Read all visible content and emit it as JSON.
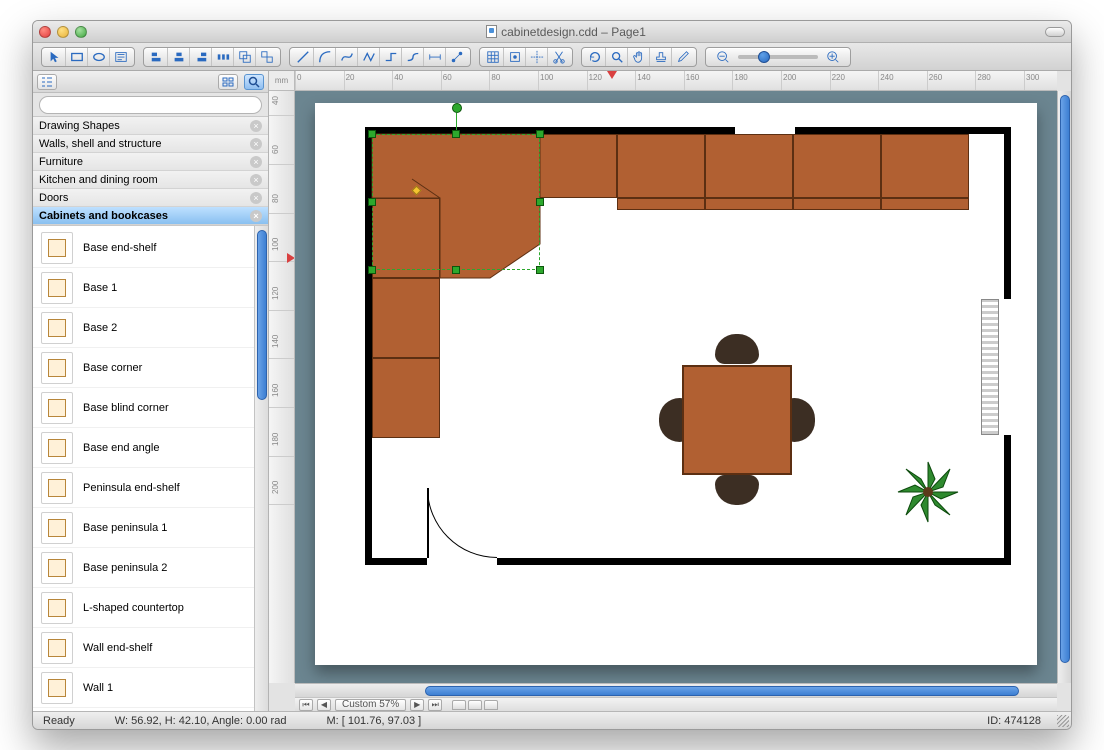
{
  "window": {
    "title": "cabinetdesign.cdd – Page1"
  },
  "ruler_unit": "mm",
  "search": {
    "placeholder": ""
  },
  "categories": [
    {
      "label": "Drawing Shapes"
    },
    {
      "label": "Walls, shell and structure"
    },
    {
      "label": "Furniture"
    },
    {
      "label": "Kitchen and dining room"
    },
    {
      "label": "Doors"
    },
    {
      "label": "Cabinets and bookcases",
      "active": true
    }
  ],
  "shapes": [
    {
      "label": "Base end-shelf"
    },
    {
      "label": "Base 1"
    },
    {
      "label": "Base 2"
    },
    {
      "label": "Base corner"
    },
    {
      "label": "Base blind corner"
    },
    {
      "label": "Base end angle"
    },
    {
      "label": "Peninsula end-shelf"
    },
    {
      "label": "Base peninsula 1"
    },
    {
      "label": "Base peninsula 2"
    },
    {
      "label": "L-shaped countertop"
    },
    {
      "label": "Wall end-shelf"
    },
    {
      "label": "Wall 1"
    }
  ],
  "h_ticks": [
    0,
    20,
    40,
    60,
    80,
    100,
    120,
    140,
    160,
    180,
    200,
    220,
    240,
    260,
    280,
    300
  ],
  "v_ticks": [
    40,
    60,
    80,
    100,
    120,
    140,
    160,
    180,
    200
  ],
  "pager": {
    "zoom_label": "Custom 57%"
  },
  "status": {
    "ready": "Ready",
    "dims": "W: 56.92,  H: 42.10,  Angle: 0.00 rad",
    "mouse": "M: [ 101.76, 97.03 ]",
    "id": "ID: 474128"
  }
}
